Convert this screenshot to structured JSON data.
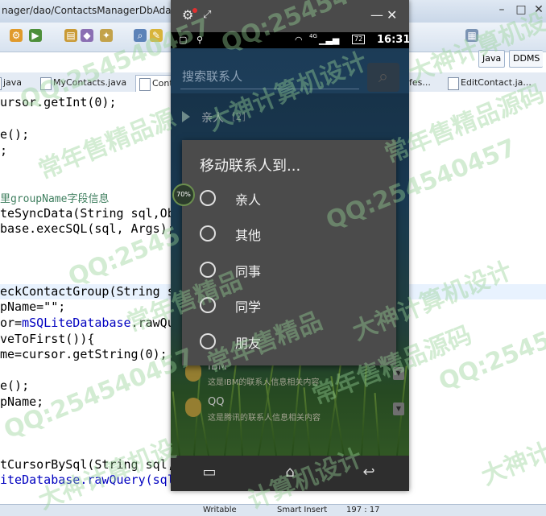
{
  "ide": {
    "window_title": "nager/dao/ContactsManagerDbAdater.java",
    "perspectives": [
      "Java",
      "DDMS"
    ],
    "tabs": [
      "java",
      "MyContacts.java",
      "Cont",
      "fes...",
      "EditContact.ja..."
    ],
    "code_lines": [
      {
        "text": "ursor.getInt(0);"
      },
      {
        "text": "e();"
      },
      {
        "text": ";"
      },
      {
        "text": "里groupName字段信息",
        "kind": "comment"
      },
      {
        "text": "teSyncData(String sql,Ob"
      },
      {
        "text": "base.execSQL(sql, Args);"
      },
      {
        "text": "eckContactGroup(String s"
      },
      {
        "text": "pName=\"\";"
      },
      {
        "pre": "or=",
        "field": "mSQLiteDatabase",
        "post": ".rawQue"
      },
      {
        "text": "veToFirst()){"
      },
      {
        "text": "me=cursor.getString(0);"
      },
      {
        "text": "e();"
      },
      {
        "text": "pName;"
      },
      {
        "text": "tCursorBySql(String sql,"
      },
      {
        "text": "iteDatabase.rawQuery(sql,"
      }
    ],
    "status": {
      "writable": "Writable",
      "insert_mode": "Smart Insert",
      "position": "197 : 17"
    }
  },
  "watermarks": [
    "QQ:254540457",
    "常年售精品源",
    "大神计算机设",
    "常年售精品源码",
    "QQ:254540457",
    "大神计算机设计",
    "QQ:254540457",
    "常年售精品源码",
    "QQ:2545",
    "大神计算机设计",
    "QQ:254540457",
    "常年售精品",
    "QQ:254540457",
    "大神计算机设计",
    "常年售精品",
    "大神计算机设",
    "计算机设计"
  ],
  "phone": {
    "status": {
      "network": "4G",
      "battery": "72",
      "time": "16:31"
    },
    "search_placeholder": "搜索联系人",
    "group": {
      "name": "亲人",
      "count": "[2]"
    },
    "contacts": [
      {
        "name": "IBM",
        "detail": "这是IBM的联系人信息相关内容"
      },
      {
        "name": "QQ",
        "detail": "这是腾讯的联系人信息相关内容"
      }
    ],
    "progress_label": "70%",
    "progress_value": 70,
    "dialog": {
      "title": "移动联系人到...",
      "options": [
        "亲人",
        "其他",
        "同事",
        "同学",
        "朋友"
      ]
    }
  }
}
